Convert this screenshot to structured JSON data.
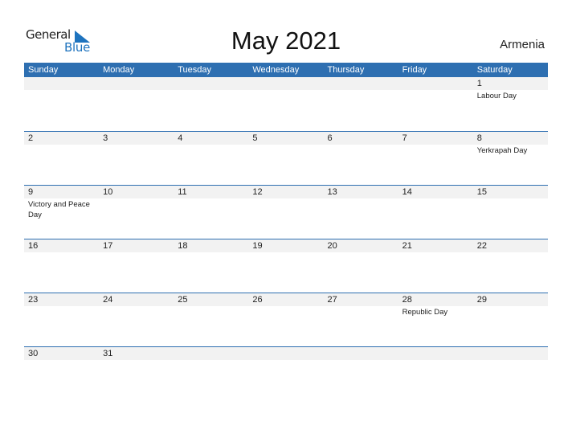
{
  "logo": {
    "part1": "General",
    "part2": "Blue"
  },
  "title": "May 2021",
  "country": "Armenia",
  "days_of_week": [
    "Sunday",
    "Monday",
    "Tuesday",
    "Wednesday",
    "Thursday",
    "Friday",
    "Saturday"
  ],
  "weeks": [
    [
      {
        "day": "",
        "holiday": ""
      },
      {
        "day": "",
        "holiday": ""
      },
      {
        "day": "",
        "holiday": ""
      },
      {
        "day": "",
        "holiday": ""
      },
      {
        "day": "",
        "holiday": ""
      },
      {
        "day": "",
        "holiday": ""
      },
      {
        "day": "1",
        "holiday": "Labour Day"
      }
    ],
    [
      {
        "day": "2",
        "holiday": ""
      },
      {
        "day": "3",
        "holiday": ""
      },
      {
        "day": "4",
        "holiday": ""
      },
      {
        "day": "5",
        "holiday": ""
      },
      {
        "day": "6",
        "holiday": ""
      },
      {
        "day": "7",
        "holiday": ""
      },
      {
        "day": "8",
        "holiday": "Yerkrapah Day"
      }
    ],
    [
      {
        "day": "9",
        "holiday": "Victory and Peace Day"
      },
      {
        "day": "10",
        "holiday": ""
      },
      {
        "day": "11",
        "holiday": ""
      },
      {
        "day": "12",
        "holiday": ""
      },
      {
        "day": "13",
        "holiday": ""
      },
      {
        "day": "14",
        "holiday": ""
      },
      {
        "day": "15",
        "holiday": ""
      }
    ],
    [
      {
        "day": "16",
        "holiday": ""
      },
      {
        "day": "17",
        "holiday": ""
      },
      {
        "day": "18",
        "holiday": ""
      },
      {
        "day": "19",
        "holiday": ""
      },
      {
        "day": "20",
        "holiday": ""
      },
      {
        "day": "21",
        "holiday": ""
      },
      {
        "day": "22",
        "holiday": ""
      }
    ],
    [
      {
        "day": "23",
        "holiday": ""
      },
      {
        "day": "24",
        "holiday": ""
      },
      {
        "day": "25",
        "holiday": ""
      },
      {
        "day": "26",
        "holiday": ""
      },
      {
        "day": "27",
        "holiday": ""
      },
      {
        "day": "28",
        "holiday": "Republic Day"
      },
      {
        "day": "29",
        "holiday": ""
      }
    ],
    [
      {
        "day": "30",
        "holiday": ""
      },
      {
        "day": "31",
        "holiday": ""
      },
      {
        "day": "",
        "holiday": ""
      },
      {
        "day": "",
        "holiday": ""
      },
      {
        "day": "",
        "holiday": ""
      },
      {
        "day": "",
        "holiday": ""
      },
      {
        "day": "",
        "holiday": ""
      }
    ]
  ],
  "colors": {
    "header_bg": "#2e6fb1",
    "logo_blue": "#1e73be",
    "band": "#f2f2f2"
  }
}
